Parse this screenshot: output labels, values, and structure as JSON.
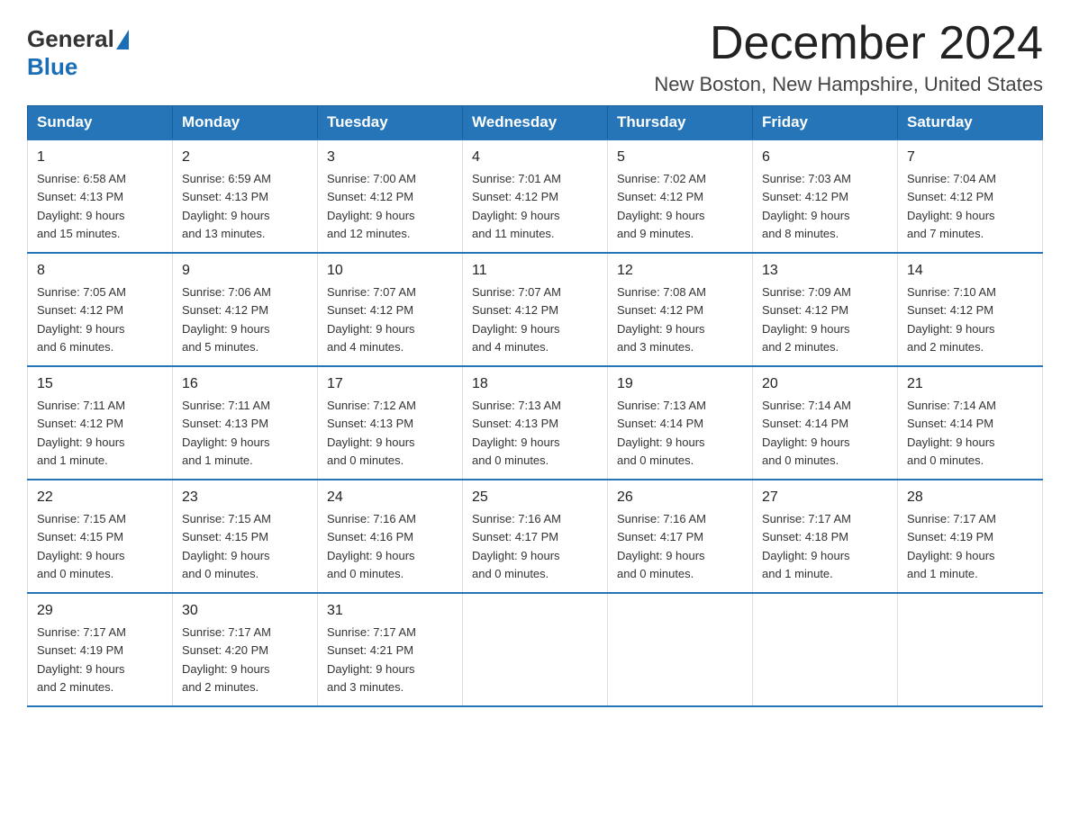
{
  "logo": {
    "general": "General",
    "blue": "Blue"
  },
  "header": {
    "month_year": "December 2024",
    "location": "New Boston, New Hampshire, United States"
  },
  "days_of_week": [
    "Sunday",
    "Monday",
    "Tuesday",
    "Wednesday",
    "Thursday",
    "Friday",
    "Saturday"
  ],
  "weeks": [
    [
      {
        "day": "1",
        "sunrise": "6:58 AM",
        "sunset": "4:13 PM",
        "daylight": "9 hours and 15 minutes."
      },
      {
        "day": "2",
        "sunrise": "6:59 AM",
        "sunset": "4:13 PM",
        "daylight": "9 hours and 13 minutes."
      },
      {
        "day": "3",
        "sunrise": "7:00 AM",
        "sunset": "4:12 PM",
        "daylight": "9 hours and 12 minutes."
      },
      {
        "day": "4",
        "sunrise": "7:01 AM",
        "sunset": "4:12 PM",
        "daylight": "9 hours and 11 minutes."
      },
      {
        "day": "5",
        "sunrise": "7:02 AM",
        "sunset": "4:12 PM",
        "daylight": "9 hours and 9 minutes."
      },
      {
        "day": "6",
        "sunrise": "7:03 AM",
        "sunset": "4:12 PM",
        "daylight": "9 hours and 8 minutes."
      },
      {
        "day": "7",
        "sunrise": "7:04 AM",
        "sunset": "4:12 PM",
        "daylight": "9 hours and 7 minutes."
      }
    ],
    [
      {
        "day": "8",
        "sunrise": "7:05 AM",
        "sunset": "4:12 PM",
        "daylight": "9 hours and 6 minutes."
      },
      {
        "day": "9",
        "sunrise": "7:06 AM",
        "sunset": "4:12 PM",
        "daylight": "9 hours and 5 minutes."
      },
      {
        "day": "10",
        "sunrise": "7:07 AM",
        "sunset": "4:12 PM",
        "daylight": "9 hours and 4 minutes."
      },
      {
        "day": "11",
        "sunrise": "7:07 AM",
        "sunset": "4:12 PM",
        "daylight": "9 hours and 4 minutes."
      },
      {
        "day": "12",
        "sunrise": "7:08 AM",
        "sunset": "4:12 PM",
        "daylight": "9 hours and 3 minutes."
      },
      {
        "day": "13",
        "sunrise": "7:09 AM",
        "sunset": "4:12 PM",
        "daylight": "9 hours and 2 minutes."
      },
      {
        "day": "14",
        "sunrise": "7:10 AM",
        "sunset": "4:12 PM",
        "daylight": "9 hours and 2 minutes."
      }
    ],
    [
      {
        "day": "15",
        "sunrise": "7:11 AM",
        "sunset": "4:12 PM",
        "daylight": "9 hours and 1 minute."
      },
      {
        "day": "16",
        "sunrise": "7:11 AM",
        "sunset": "4:13 PM",
        "daylight": "9 hours and 1 minute."
      },
      {
        "day": "17",
        "sunrise": "7:12 AM",
        "sunset": "4:13 PM",
        "daylight": "9 hours and 0 minutes."
      },
      {
        "day": "18",
        "sunrise": "7:13 AM",
        "sunset": "4:13 PM",
        "daylight": "9 hours and 0 minutes."
      },
      {
        "day": "19",
        "sunrise": "7:13 AM",
        "sunset": "4:14 PM",
        "daylight": "9 hours and 0 minutes."
      },
      {
        "day": "20",
        "sunrise": "7:14 AM",
        "sunset": "4:14 PM",
        "daylight": "9 hours and 0 minutes."
      },
      {
        "day": "21",
        "sunrise": "7:14 AM",
        "sunset": "4:14 PM",
        "daylight": "9 hours and 0 minutes."
      }
    ],
    [
      {
        "day": "22",
        "sunrise": "7:15 AM",
        "sunset": "4:15 PM",
        "daylight": "9 hours and 0 minutes."
      },
      {
        "day": "23",
        "sunrise": "7:15 AM",
        "sunset": "4:15 PM",
        "daylight": "9 hours and 0 minutes."
      },
      {
        "day": "24",
        "sunrise": "7:16 AM",
        "sunset": "4:16 PM",
        "daylight": "9 hours and 0 minutes."
      },
      {
        "day": "25",
        "sunrise": "7:16 AM",
        "sunset": "4:17 PM",
        "daylight": "9 hours and 0 minutes."
      },
      {
        "day": "26",
        "sunrise": "7:16 AM",
        "sunset": "4:17 PM",
        "daylight": "9 hours and 0 minutes."
      },
      {
        "day": "27",
        "sunrise": "7:17 AM",
        "sunset": "4:18 PM",
        "daylight": "9 hours and 1 minute."
      },
      {
        "day": "28",
        "sunrise": "7:17 AM",
        "sunset": "4:19 PM",
        "daylight": "9 hours and 1 minute."
      }
    ],
    [
      {
        "day": "29",
        "sunrise": "7:17 AM",
        "sunset": "4:19 PM",
        "daylight": "9 hours and 2 minutes."
      },
      {
        "day": "30",
        "sunrise": "7:17 AM",
        "sunset": "4:20 PM",
        "daylight": "9 hours and 2 minutes."
      },
      {
        "day": "31",
        "sunrise": "7:17 AM",
        "sunset": "4:21 PM",
        "daylight": "9 hours and 3 minutes."
      },
      null,
      null,
      null,
      null
    ]
  ],
  "labels": {
    "sunrise": "Sunrise:",
    "sunset": "Sunset:",
    "daylight": "Daylight:"
  }
}
